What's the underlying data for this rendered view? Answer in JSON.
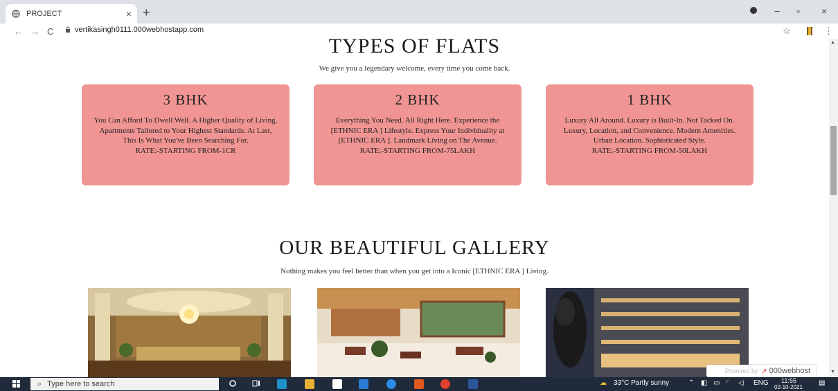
{
  "browser": {
    "tab_title": "PROJECT",
    "tab_close": "×",
    "new_tab": "+",
    "url": "vertikasingh0111.000webhostapp.com",
    "nav_back": "←",
    "nav_forward": "→",
    "nav_reload": "C",
    "win_minimize": "−",
    "win_restore": "▫",
    "win_close": "×",
    "star_icon": "☆",
    "menu_icon": "⋮"
  },
  "flats": {
    "heading": "TYPES OF FLATS",
    "subtitle": "We give you a legendary welcome, every time you come back.",
    "cards": [
      {
        "title": "3 BHK",
        "text": "You Can Afford To Dwell Well. A Higher Quality of Living. Apartments Tailored to Your Highest Standards. At Last, This Is What You've Been Searching For.",
        "rate": "RATE:-STARTING FROM-1CR"
      },
      {
        "title": "2 BHK",
        "text": "Everything You Need. All Right Here. Experience the [ETHNIC ERA ] Lifestyle. Express Your Individuality at [ETHNIC ERA ]. Landmark Living on The Avenue.",
        "rate": "RATE:-STARTING FROM-75LAKH"
      },
      {
        "title": "1 BHK",
        "text": "Luxury All Around. Luxury is Built-In. Not Tacked On. Luxury, Location, and Convenience. Modern Amenities. Urban Location. Sophisticated Style.",
        "rate": "RATE:-STARTING FROM-50LAKH"
      }
    ]
  },
  "gallery": {
    "heading": "OUR BEAUTIFUL GALLERY",
    "subtitle": "Nothing makes you feel better than when you get into a Iconic [ETHNIC ERA ] Living."
  },
  "badge": {
    "powered": "Powered by",
    "brand": "000webhost"
  },
  "taskbar": {
    "search_placeholder": "Type here to search",
    "weather": "33°C  Partly sunny",
    "lang": "ENG",
    "time": "11:55",
    "date": "02-10-2021"
  },
  "colors": {
    "card_bg": "#f09593",
    "taskbar": "#1f2a3a",
    "tabstrip": "#dee1e6"
  }
}
